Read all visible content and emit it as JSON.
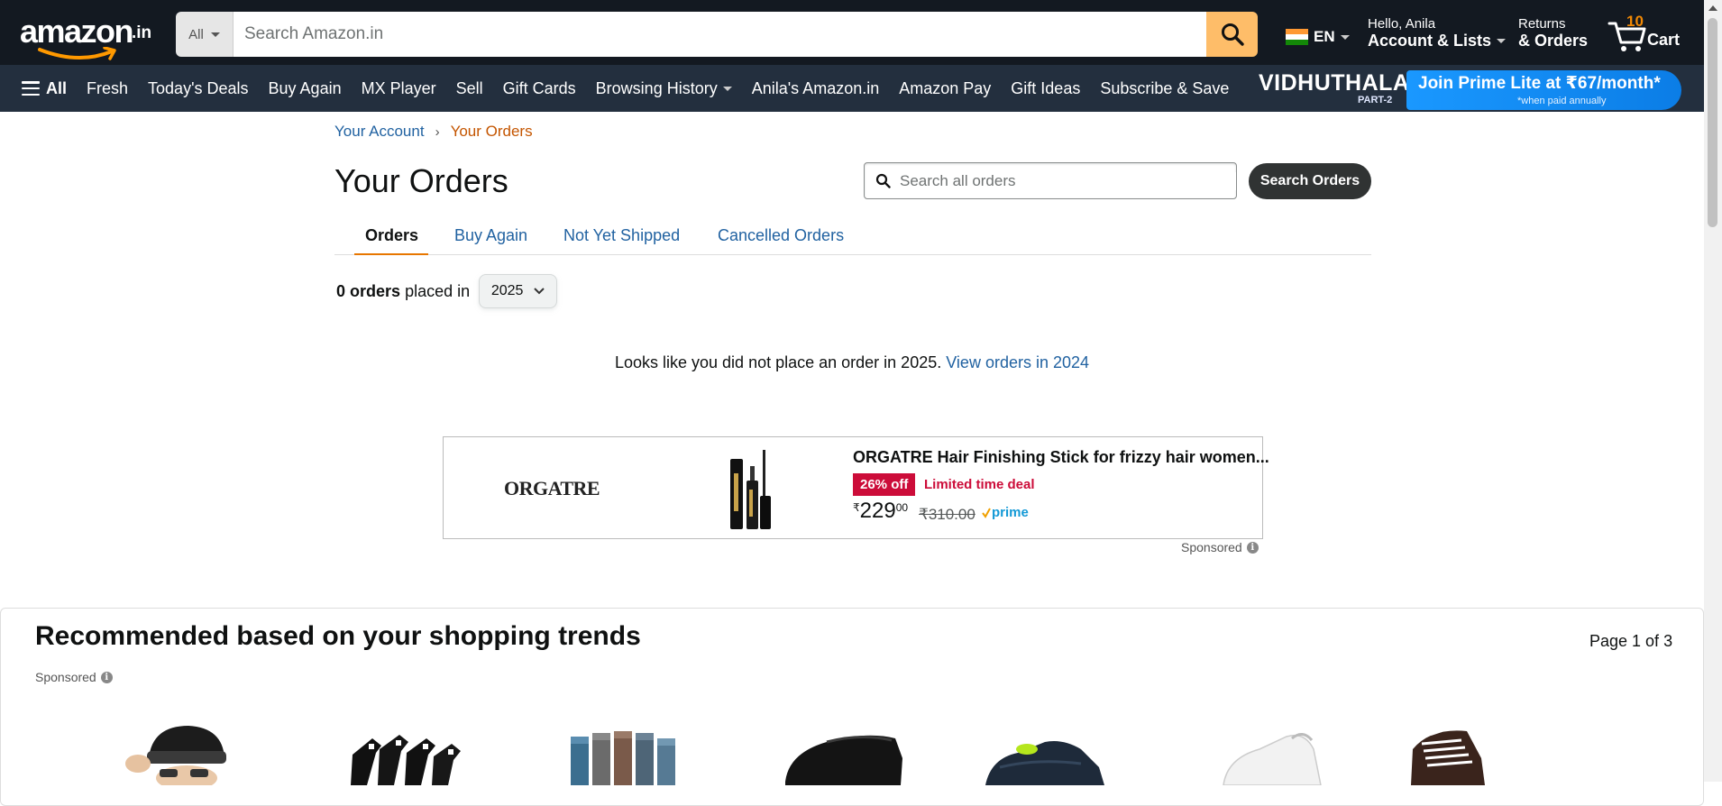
{
  "header": {
    "logo_word": "amazon",
    "logo_tld": ".in",
    "search_category": "All",
    "search_placeholder": "Search Amazon.in",
    "language": "EN",
    "account_greeting": "Hello, Anila",
    "account_label": "Account & Lists",
    "returns_line1": "Returns",
    "returns_line2": "& Orders",
    "cart_count": "10",
    "cart_label": "Cart",
    "colors": {
      "nav_bg": "#131921",
      "subnav_bg": "#232f3e",
      "search_button": "#febd69",
      "cart_count": "#f08804"
    }
  },
  "subnav": {
    "all_label": "All",
    "items": [
      "Fresh",
      "Today's Deals",
      "Buy Again",
      "MX Player",
      "Sell",
      "Gift Cards",
      "Browsing History",
      "Anila's Amazon.in",
      "Amazon Pay",
      "Gift Ideas",
      "Subscribe & Save"
    ],
    "promo": {
      "title": "VIDHUTHALAI",
      "subtitle": "PART-2",
      "cta": "Join Prime Lite at ₹67/month*",
      "note": "*when paid annually"
    }
  },
  "breadcrumb": {
    "parent": "Your Account",
    "separator": "›",
    "current": "Your Orders"
  },
  "orders": {
    "title": "Your Orders",
    "search_placeholder": "Search all orders",
    "search_button": "Search Orders",
    "tabs": [
      "Orders",
      "Buy Again",
      "Not Yet Shipped",
      "Cancelled Orders"
    ],
    "active_tab": "Orders",
    "count_bold": "0 orders",
    "count_suffix": "placed in",
    "year": "2025",
    "empty_message": "Looks like you did not place an order in 2025.",
    "empty_link": "View orders in 2024"
  },
  "ad": {
    "brand": "ORGATRE",
    "title": "ORGATRE Hair Finishing Stick for frizzy hair women...",
    "discount_badge": "26% off",
    "deal_label": "Limited time deal",
    "price_symbol": "₹",
    "price_whole": "229",
    "price_fraction": "00",
    "mrp": "₹310.00",
    "prime_label": "prime",
    "sponsored": "Sponsored"
  },
  "recommendations": {
    "title": "Recommended based on your shopping trends",
    "page_indicator": "Page 1 of 3",
    "sponsored": "Sponsored",
    "products": [
      "beanie-cap",
      "black-socks",
      "colored-socks",
      "black-loafer",
      "navy-sneaker",
      "white-sneaker",
      "brown-sneaker"
    ]
  }
}
